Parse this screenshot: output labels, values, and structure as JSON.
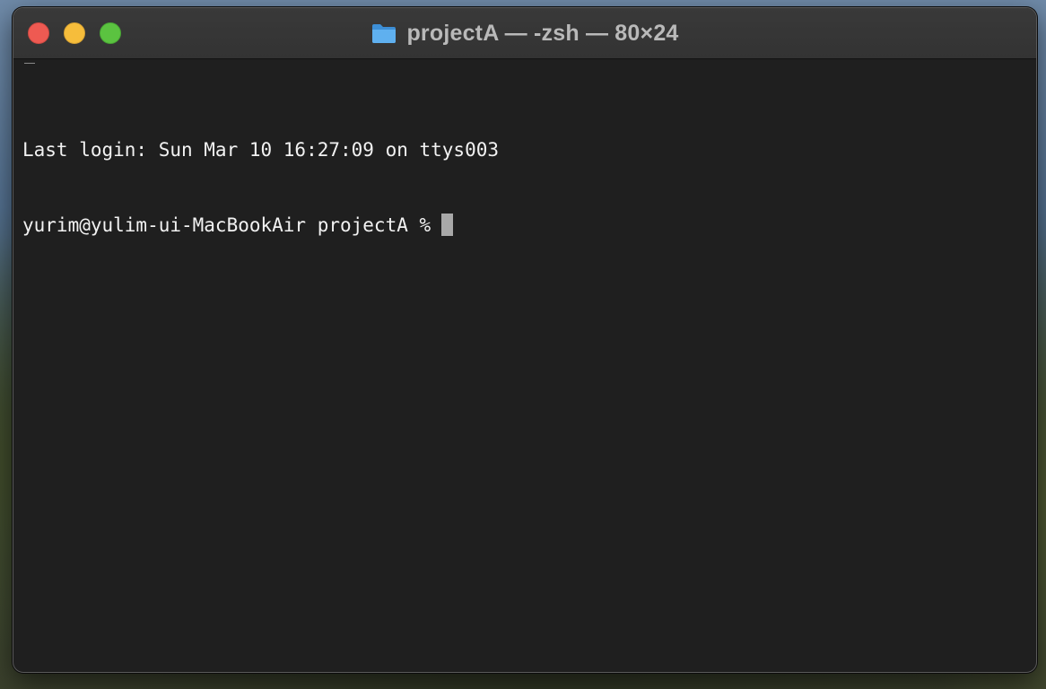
{
  "window": {
    "title": "projectA — -zsh — 80×24",
    "title_icon": "folder-icon"
  },
  "traffic_lights": {
    "close_color": "#ee5a52",
    "minimize_color": "#f6bd3b",
    "zoom_color": "#5bc340"
  },
  "terminal": {
    "background_color": "#1f1f1f",
    "text_color": "#f2f2f2",
    "lines": [
      "Last login: Sun Mar 10 16:27:09 on ttys003",
      "yurim@yulim-ui-MacBookAir projectA %"
    ]
  }
}
